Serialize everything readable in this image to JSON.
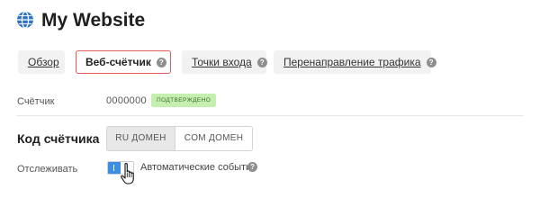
{
  "header": {
    "title": "My Website",
    "icon": "globe-icon",
    "icon_color": "#2f74c6"
  },
  "tabs": [
    {
      "label": "Обзор",
      "help": false,
      "active": false
    },
    {
      "label": "Веб-счётчик",
      "help": true,
      "active": true
    },
    {
      "label": "Точки входа",
      "help": true,
      "active": false
    },
    {
      "label": "Перенаправление трафика",
      "help": true,
      "active": false
    }
  ],
  "help_glyph": "?",
  "counter": {
    "label": "Счётчик",
    "value": "0000000",
    "status_badge": "ПОДТВЕРЖДЕНО"
  },
  "code": {
    "heading": "Код счётчика",
    "options": [
      {
        "label": "RU ДОМЕН",
        "selected": true
      },
      {
        "label": "COM ДОМЕН",
        "selected": false
      }
    ]
  },
  "tracking": {
    "label": "Отслеживать",
    "toggle_on": true,
    "option_label": "Автоматические события"
  },
  "colors": {
    "accent": "#3b8ee6",
    "active_tab_border": "#e45b5b",
    "badge_bg": "#c5efb0",
    "badge_text": "#3a6b2b"
  }
}
